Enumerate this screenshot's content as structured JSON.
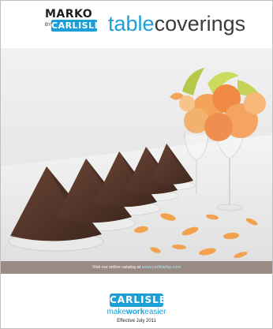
{
  "header": {
    "brand_top": "MARKO",
    "brand_by": "BY",
    "brand_logo": "CARLISLE",
    "title_part1": "table",
    "title_part2": "coverings"
  },
  "caption": {
    "text": "Visit our online catalog at",
    "link": "www.carlislefsp.com"
  },
  "footer": {
    "logo": "CARLISLE",
    "slogan_1": "make",
    "slogan_2": "work",
    "slogan_3": "easier",
    "effective": "Effective July 2011"
  },
  "colors": {
    "brand_blue": "#1aa0d7",
    "napkin": "#5a3a2c",
    "flower": "#f39a4a"
  }
}
